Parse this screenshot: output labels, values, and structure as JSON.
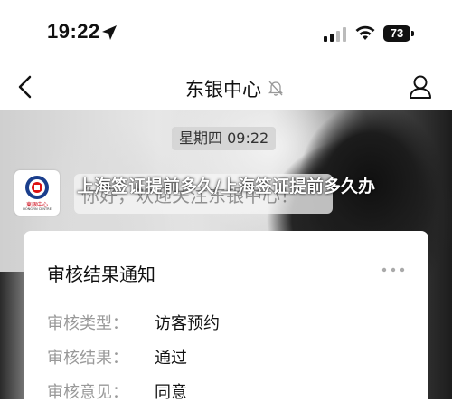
{
  "status_bar": {
    "time": "19:22",
    "battery": "73"
  },
  "nav": {
    "title": "东银中心"
  },
  "chat": {
    "timestamp": "星期四 09:22",
    "avatar_logo": "東銀中心",
    "avatar_logo_sub": "DONGYIN CENTRE",
    "welcome_message": "你好，欢迎关注东银中心！"
  },
  "overlay": {
    "headline": "上海签证提前多久/上海签证提前多久办"
  },
  "card": {
    "title": "审核结果通知",
    "rows": [
      {
        "label": "审核类型：",
        "value": "访客预约"
      },
      {
        "label": "审核结果：",
        "value": "通过"
      },
      {
        "label": "审核意见：",
        "value": "同意"
      }
    ]
  },
  "colors": {
    "accent_red": "#cc1111",
    "card_bg": "#ffffff",
    "label_gray": "#999999"
  },
  "icons": [
    "location-arrow-icon",
    "signal-icon",
    "wifi-icon",
    "back-chevron-icon",
    "mute-bell-icon",
    "user-icon",
    "more-dots-icon"
  ]
}
